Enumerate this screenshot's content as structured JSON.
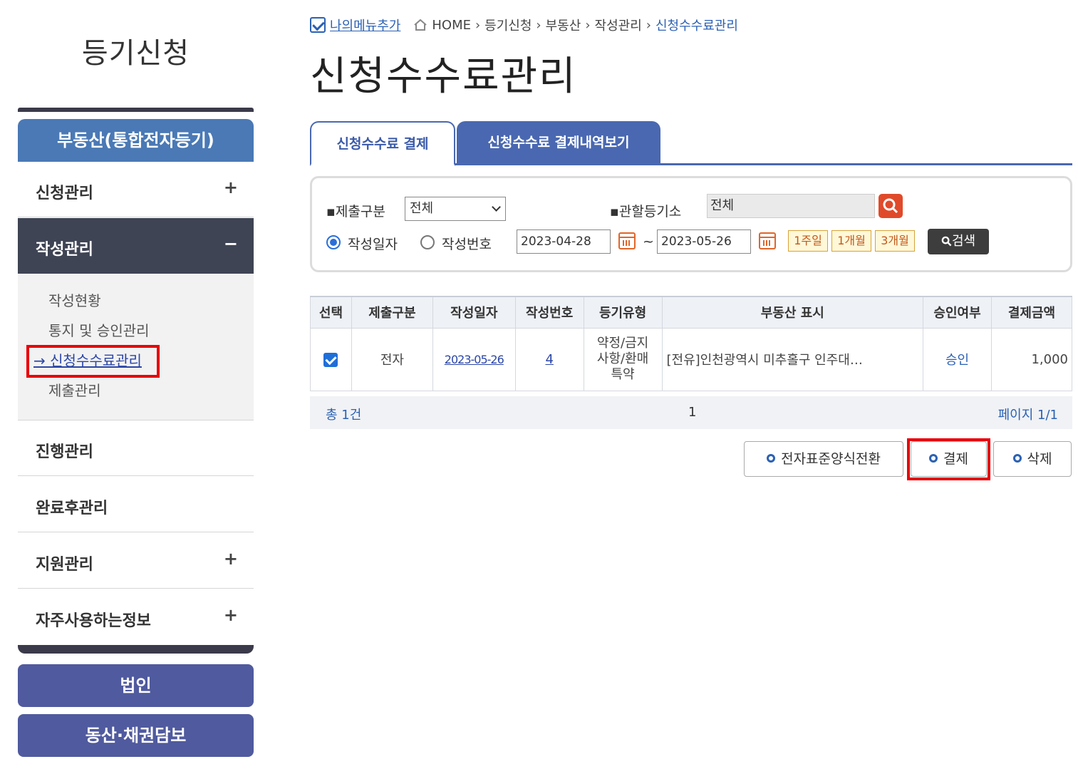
{
  "sidebar": {
    "title": "등기신청",
    "category": "부동산(통합전자등기)",
    "menu": [
      {
        "label": "신청관리",
        "sign": "+"
      },
      {
        "label": "작성관리",
        "sign": "−"
      },
      {
        "label": "진행관리",
        "sign": ""
      },
      {
        "label": "완료후관리",
        "sign": ""
      },
      {
        "label": "지원관리",
        "sign": "+"
      },
      {
        "label": "자주사용하는정보",
        "sign": "+"
      }
    ],
    "submenu": [
      "작성현황",
      "통지 및 승인관리",
      "→ 신청수수료관리",
      "제출관리"
    ],
    "buttons": [
      "법인",
      "동산·채권담보"
    ]
  },
  "breadcrumb": {
    "mymenu": "나의메뉴추가",
    "items": [
      "HOME",
      "등기신청",
      "부동산",
      "작성관리",
      "신청수수료관리"
    ]
  },
  "page_title": "신청수수료관리",
  "tabs": [
    "신청수수료 결제",
    "신청수수료 결제내역보기"
  ],
  "search": {
    "submit_type_label": "▪제출구분",
    "submit_type_value": "전체",
    "office_label": "▪관할등기소",
    "office_value": "전체",
    "radio_date": "작성일자",
    "radio_number": "작성번호",
    "date_from": "2023-04-28",
    "date_sep": "~",
    "date_to": "2023-05-26",
    "periods": [
      "1주일",
      "1개월",
      "3개월"
    ],
    "search_button": "검색"
  },
  "table": {
    "headers": [
      "선택",
      "제출구분",
      "작성일자",
      "작성번호",
      "등기유형",
      "부동산 표시",
      "승인여부",
      "결제금액"
    ],
    "rows": [
      {
        "submit_type": "전자",
        "date": "2023-05-26",
        "number": "4",
        "type_line1": "약정/금지",
        "type_line2": "사항/환매",
        "type_line3": "특약",
        "property": "[전유]인천광역시 미추홀구 인주대…",
        "approval": "승인",
        "amount": "1,000"
      }
    ]
  },
  "footer": {
    "total": "총 1건",
    "page": "1",
    "page_info": "페이지 1/1"
  },
  "actions": [
    "전자표준양식전환",
    "결제",
    "삭제"
  ],
  "colors": {
    "accent": "#4a68b1",
    "highlight": "#e8000b",
    "sidebar_active": "#3f4454"
  }
}
